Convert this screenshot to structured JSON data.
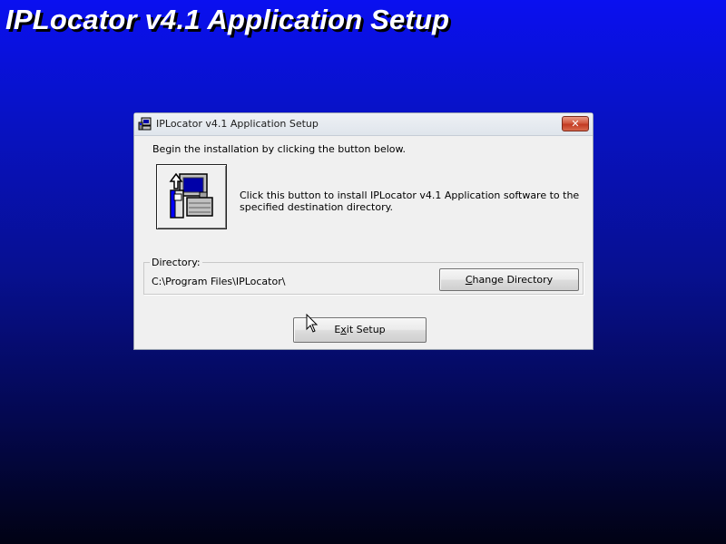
{
  "screen": {
    "banner_title": "IPLocator v4.1 Application Setup"
  },
  "dialog": {
    "title": "IPLocator v4.1 Application Setup",
    "close_glyph": "✕",
    "intro_text": "Begin the installation by clicking the button below.",
    "install_description": "Click this button to install IPLocator v4.1 Application software to the specified destination directory.",
    "directory": {
      "legend": "Directory:",
      "path": "C:\\Program Files\\IPLocator\\"
    },
    "buttons": {
      "change_directory": "Change Directory",
      "change_directory_mnemonic": "C",
      "exit_setup": "Exit Setup",
      "exit_setup_mnemonic": "x"
    }
  },
  "icons": {
    "title": "setup-computer-icon",
    "install": "install-computer-icon",
    "close": "close-icon",
    "cursor": "mouse-pointer-icon"
  },
  "colors": {
    "background_top": "#0a10f0",
    "background_bottom": "#010214",
    "close_button": "#c23b22",
    "dialog_face": "#f0f0f0"
  }
}
